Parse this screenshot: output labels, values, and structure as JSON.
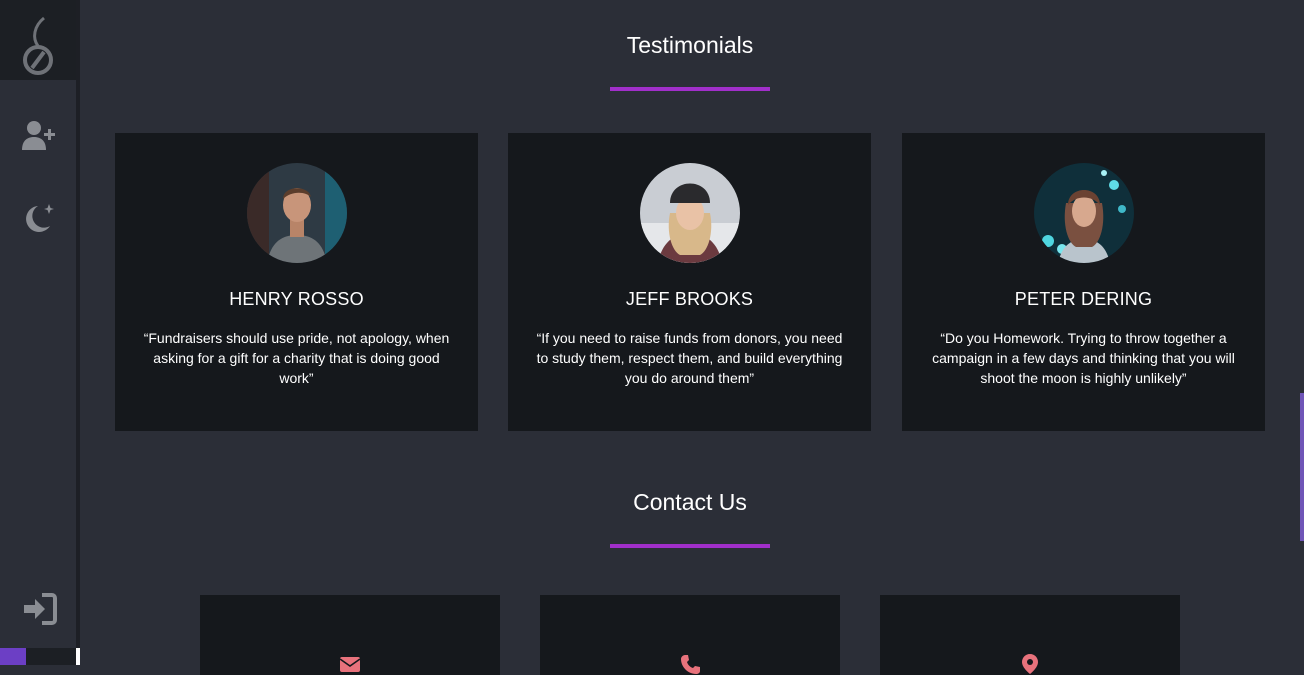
{
  "sidebar": {
    "icons": [
      "logo-icon",
      "add-user-icon",
      "dark-mode-icon",
      "sign-in-icon"
    ]
  },
  "testimonials": {
    "title": "Testimonials",
    "cards": [
      {
        "name": "HENRY ROSSO",
        "quote": "“Fundraisers should use pride, not apology, when asking for a gift for a charity that is doing good work”"
      },
      {
        "name": "JEFF BROOKS",
        "quote": "“If you need to raise funds from donors, you need to study them, respect them, and build everything you do around them”"
      },
      {
        "name": "PETER DERING",
        "quote": "“Do you Homework. Trying to throw together a campaign in a few days and thinking that you will shoot the moon is highly unlikely”"
      }
    ]
  },
  "contact": {
    "title": "Contact Us",
    "icons": [
      "envelope-icon",
      "phone-icon",
      "map-marker-icon"
    ]
  },
  "colors": {
    "background": "#2b2e37",
    "card": "#15181c",
    "accent": "#a12fca",
    "icon": "#8a8d93",
    "contact_icon": "#e8727c"
  }
}
